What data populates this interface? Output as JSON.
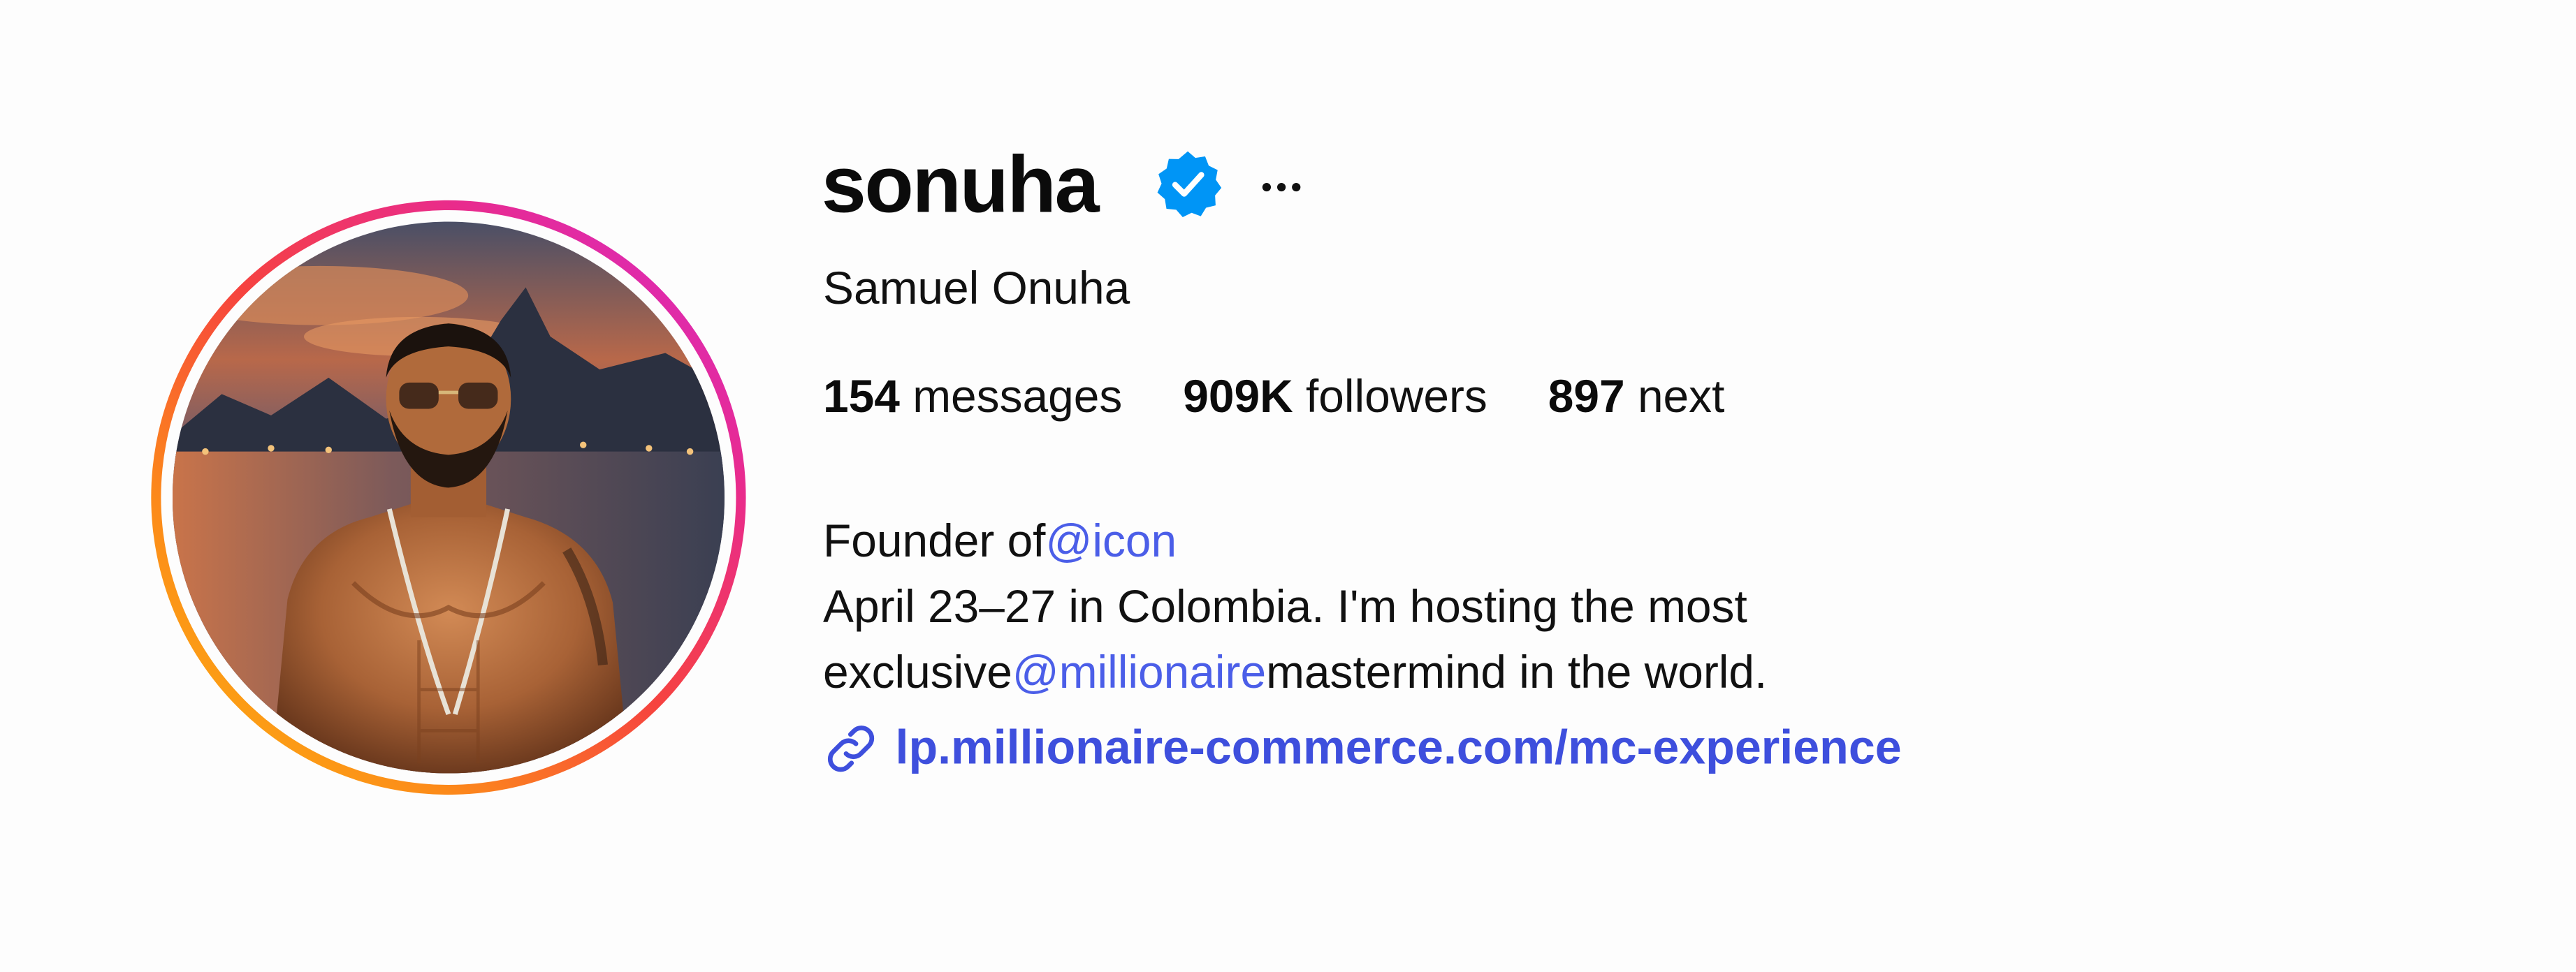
{
  "profile": {
    "username": "sonuha",
    "full_name": "Samuel Onuha",
    "verified": true,
    "more_label": "···"
  },
  "stats": {
    "posts_count": "154",
    "posts_label": "messages",
    "followers_count": "909K",
    "followers_label": "followers",
    "following_count": "897",
    "following_label": "next"
  },
  "bio": {
    "line1_text": "Founder of",
    "line1_mention": "@icon",
    "line2_text": "April 23–27 in Colombia. I'm hosting the most",
    "line3_prefix": "exclusive",
    "line3_mention": "@millionaire",
    "line3_suffix": "mastermind in the world."
  },
  "link": {
    "url": "lp.millionaire-commerce.com/mc-experience"
  },
  "colors": {
    "mention": "#4b5ee8",
    "link": "#3e4fdd",
    "verified": "#0095f6"
  },
  "icons": {
    "verified": "verified-badge-icon",
    "link": "link-icon",
    "more": "more-options-icon"
  }
}
